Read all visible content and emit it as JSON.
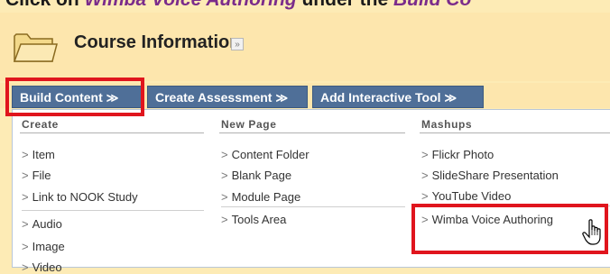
{
  "instruction": {
    "prefix": "Click on ",
    "highlight": "Wimba Voice Authoring",
    "middle": " under the ",
    "tail": "Build Co"
  },
  "page": {
    "title": "Course Information",
    "title_menu_icon": "chevron-double-down-icon"
  },
  "toolbar": {
    "buttons": [
      {
        "label": "Build Content",
        "icon": "chevron-double-down-icon"
      },
      {
        "label": "Create Assessment",
        "icon": "chevron-double-down-icon"
      },
      {
        "label": "Add Interactive Tool",
        "icon": "chevron-double-down-icon"
      }
    ]
  },
  "menu": {
    "columns": [
      {
        "header": "Create",
        "groups": [
          [
            "Item",
            "File",
            "Link to NOOK Study"
          ],
          [
            "Audio",
            "Image",
            "Video"
          ]
        ]
      },
      {
        "header": "New Page",
        "groups": [
          [
            "Content Folder",
            "Blank Page",
            "Module Page"
          ],
          [
            "Tools Area"
          ]
        ]
      },
      {
        "header": "Mashups",
        "groups": [
          [
            "Flickr Photo",
            "SlideShare Presentation",
            "YouTube Video"
          ],
          [
            "Wimba Voice Authoring"
          ]
        ]
      }
    ]
  },
  "colors": {
    "header_bg": "#fde6ad",
    "toolbar_button": "#4f6f98",
    "highlight_box": "#e0151d",
    "instruction_highlight": "#7b2c8b"
  }
}
